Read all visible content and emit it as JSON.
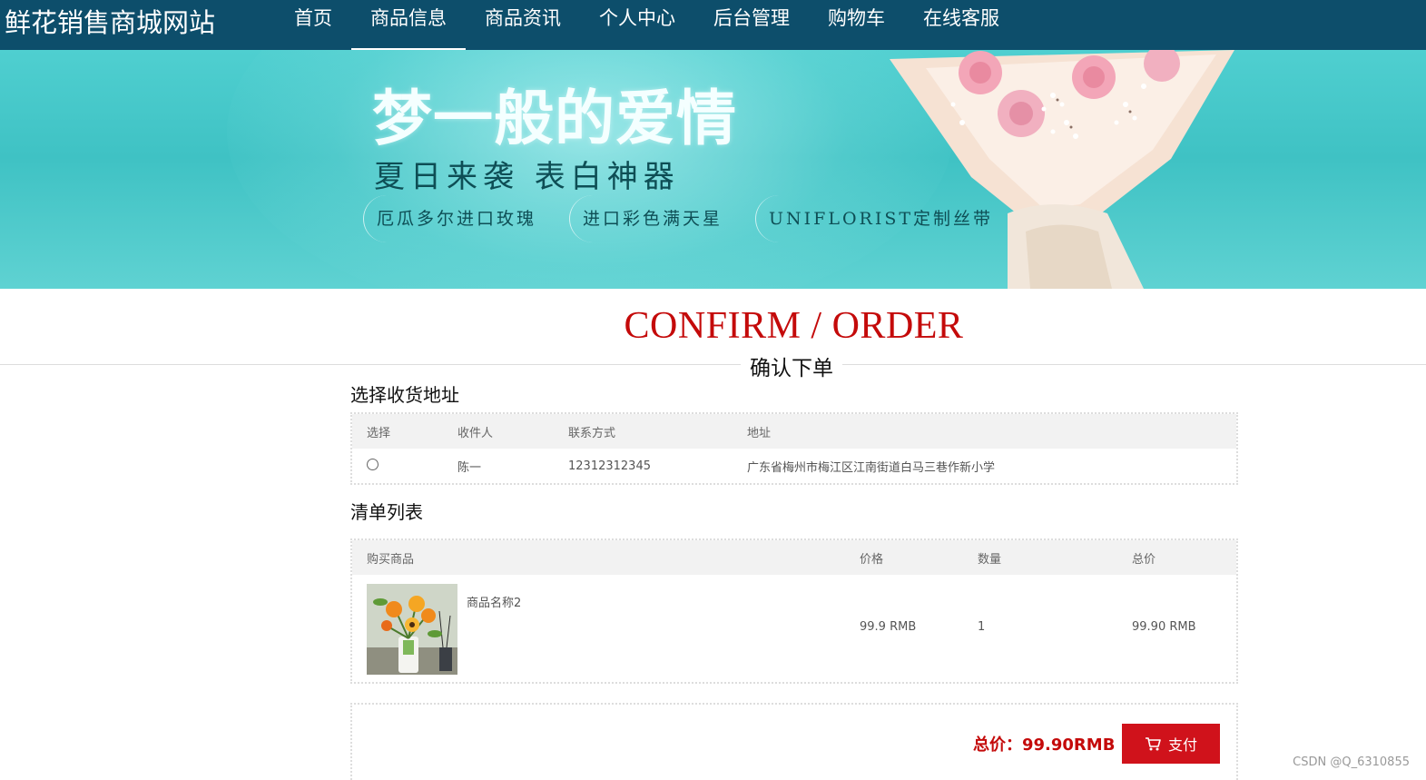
{
  "site": {
    "brand": "鲜花销售商城网站"
  },
  "nav": {
    "items": [
      {
        "label": "首页"
      },
      {
        "label": "商品信息"
      },
      {
        "label": "商品资讯"
      },
      {
        "label": "个人中心"
      },
      {
        "label": "后台管理"
      },
      {
        "label": "购物车"
      },
      {
        "label": "在线客服"
      }
    ],
    "active_index": 1
  },
  "banner": {
    "headline": "梦一般的爱情",
    "subheadline": "夏日来袭  表白神器",
    "tags": [
      "厄瓜多尔进口玫瑰",
      "进口彩色满天星",
      "UNIFLORIST定制丝带"
    ]
  },
  "page": {
    "title_en": "CONFIRM / ORDER",
    "title_cn": "确认下单"
  },
  "address": {
    "heading": "选择收货地址",
    "columns": [
      "选择",
      "收件人",
      "联系方式",
      "地址"
    ],
    "rows": [
      {
        "recipient": "陈一",
        "phone": "12312312345",
        "address": "广东省梅州市梅江区江南街道白马三巷作新小学",
        "selected": false
      }
    ]
  },
  "cart": {
    "heading": "清单列表",
    "columns": [
      "购买商品",
      "价格",
      "数量",
      "总价"
    ],
    "rows": [
      {
        "name": "商品名称2",
        "price": "99.9 RMB",
        "qty": "1",
        "total": "99.90 RMB",
        "image": "flower-vase-thumbnail"
      }
    ]
  },
  "summary": {
    "total_text": "总价：99.90RMB",
    "pay_label": "支付",
    "pay_icon": "cart-icon"
  },
  "watermark": "CSDN @Q_6310855",
  "colors": {
    "nav_bg": "#0d4e6b",
    "accent_red": "#c40a0a",
    "button_red": "#d0121b"
  }
}
